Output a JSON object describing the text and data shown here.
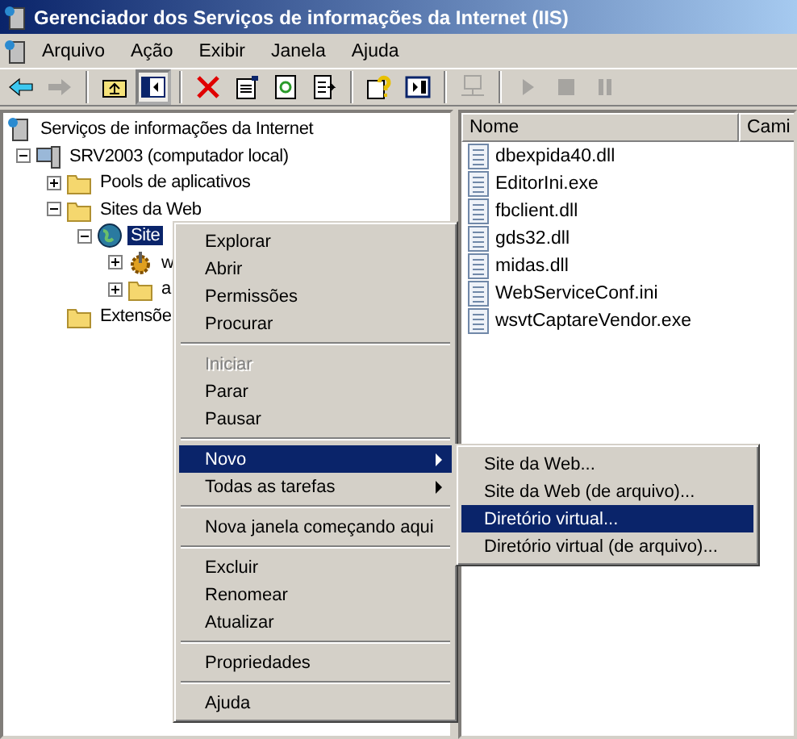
{
  "window": {
    "title": "Gerenciador dos Serviços de informações da Internet (IIS)"
  },
  "menu_bar": [
    {
      "label": "Arquivo"
    },
    {
      "label": "Ação"
    },
    {
      "label": "Exibir"
    },
    {
      "label": "Janela"
    },
    {
      "label": "Ajuda"
    }
  ],
  "toolbar": [
    {
      "kind": "back",
      "disabled": false,
      "pressed": false
    },
    {
      "kind": "forward",
      "disabled": true,
      "pressed": false
    },
    {
      "kind": "sep"
    },
    {
      "kind": "up",
      "disabled": false,
      "pressed": false
    },
    {
      "kind": "tree",
      "disabled": false,
      "pressed": true
    },
    {
      "kind": "sep"
    },
    {
      "kind": "delete",
      "disabled": false,
      "pressed": false
    },
    {
      "kind": "properties",
      "disabled": false,
      "pressed": false
    },
    {
      "kind": "refresh",
      "disabled": false,
      "pressed": false
    },
    {
      "kind": "export",
      "disabled": false,
      "pressed": false
    },
    {
      "kind": "sep"
    },
    {
      "kind": "help",
      "disabled": false,
      "pressed": false
    },
    {
      "kind": "panel",
      "disabled": false,
      "pressed": false
    },
    {
      "kind": "sep"
    },
    {
      "kind": "computer",
      "disabled": true,
      "pressed": false
    },
    {
      "kind": "sep"
    },
    {
      "kind": "play",
      "disabled": true,
      "pressed": false
    },
    {
      "kind": "stop",
      "disabled": true,
      "pressed": false
    },
    {
      "kind": "pause",
      "disabled": true,
      "pressed": false
    }
  ],
  "tree": [
    {
      "label": "Serviços de informações da Internet",
      "kind": "iis",
      "selected": false,
      "children": [
        {
          "label": "SRV2003 (computador local)",
          "kind": "computer",
          "selected": false,
          "expanded": true,
          "children": [
            {
              "label": "Pools de aplicativos",
              "kind": "folder",
              "selected": false,
              "expanded": false
            },
            {
              "label": "Sites da Web",
              "kind": "folder",
              "selected": false,
              "expanded": true,
              "children": [
                {
                  "label": "Site",
                  "kind": "globe",
                  "selected": true,
                  "expanded": true,
                  "children": [
                    {
                      "label": "w",
                      "kind": "gear",
                      "selected": false,
                      "expanded": false
                    },
                    {
                      "label": "a",
                      "kind": "folder",
                      "selected": false,
                      "expanded": false
                    }
                  ]
                }
              ]
            },
            {
              "label": "Extensõe",
              "kind": "folder",
              "selected": false
            }
          ]
        }
      ]
    }
  ],
  "list": {
    "columns": [
      "Nome",
      "Cami"
    ],
    "rows": [
      "dbexpida40.dll",
      "EditorIni.exe",
      "fbclient.dll",
      "gds32.dll",
      "midas.dll",
      "WebServiceConf.ini",
      "wsvtCaptareVendor.exe"
    ]
  },
  "context_menu": [
    {
      "kind": "item",
      "label": "Explorar",
      "disabled": false,
      "selected": false,
      "submenu": false
    },
    {
      "kind": "item",
      "label": "Abrir",
      "disabled": false,
      "selected": false,
      "submenu": false
    },
    {
      "kind": "item",
      "label": "Permissões",
      "disabled": false,
      "selected": false,
      "submenu": false
    },
    {
      "kind": "item",
      "label": "Procurar",
      "disabled": false,
      "selected": false,
      "submenu": false
    },
    {
      "kind": "separator"
    },
    {
      "kind": "item",
      "label": "Iniciar",
      "disabled": true,
      "selected": false,
      "submenu": false
    },
    {
      "kind": "item",
      "label": "Parar",
      "disabled": false,
      "selected": false,
      "submenu": false
    },
    {
      "kind": "item",
      "label": "Pausar",
      "disabled": false,
      "selected": false,
      "submenu": false
    },
    {
      "kind": "separator"
    },
    {
      "kind": "item",
      "label": "Novo",
      "disabled": false,
      "selected": true,
      "submenu": true
    },
    {
      "kind": "item",
      "label": "Todas as tarefas",
      "disabled": false,
      "selected": false,
      "submenu": true
    },
    {
      "kind": "separator"
    },
    {
      "kind": "item",
      "label": "Nova janela começando aqui",
      "disabled": false,
      "selected": false,
      "submenu": false
    },
    {
      "kind": "separator"
    },
    {
      "kind": "item",
      "label": "Excluir",
      "disabled": false,
      "selected": false,
      "submenu": false
    },
    {
      "kind": "item",
      "label": "Renomear",
      "disabled": false,
      "selected": false,
      "submenu": false
    },
    {
      "kind": "item",
      "label": "Atualizar",
      "disabled": false,
      "selected": false,
      "submenu": false
    },
    {
      "kind": "separator"
    },
    {
      "kind": "item",
      "label": "Propriedades",
      "disabled": false,
      "selected": false,
      "submenu": false
    },
    {
      "kind": "separator"
    },
    {
      "kind": "item",
      "label": "Ajuda",
      "disabled": false,
      "selected": false,
      "submenu": false
    }
  ],
  "submenu": [
    {
      "label": "Site da Web...",
      "selected": false
    },
    {
      "label": "Site da Web (de arquivo)...",
      "selected": false
    },
    {
      "label": "Diretório virtual...",
      "selected": true
    },
    {
      "label": "Diretório virtual (de arquivo)...",
      "selected": false
    }
  ]
}
